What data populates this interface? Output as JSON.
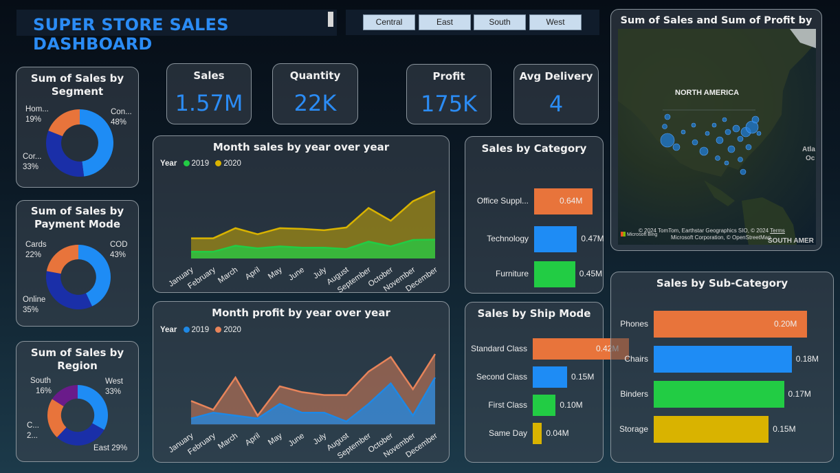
{
  "header": {
    "title": "SUPER STORE SALES DASHBOARD"
  },
  "region_slicer": {
    "options": [
      "Central",
      "East",
      "South",
      "West"
    ]
  },
  "kpis": [
    {
      "label": "Sales",
      "value": "1.57M"
    },
    {
      "label": "Quantity",
      "value": "22K"
    },
    {
      "label": "Profit",
      "value": "175K"
    },
    {
      "label": "Avg Delivery",
      "value": "4"
    }
  ],
  "segment": {
    "title_line1": "Sum of Sales by",
    "title_line2": "Segment",
    "labels": [
      {
        "name": "Hom...",
        "pct": "19%"
      },
      {
        "name": "Con...",
        "pct": "48%"
      },
      {
        "name": "Cor...",
        "pct": "33%"
      }
    ]
  },
  "payment": {
    "title_line1": "Sum of Sales by",
    "title_line2": "Payment Mode",
    "labels": [
      {
        "name": "Cards",
        "pct": "22%"
      },
      {
        "name": "COD",
        "pct": "43%"
      },
      {
        "name": "Online",
        "pct": "35%"
      }
    ]
  },
  "region": {
    "title_line1": "Sum of Sales by",
    "title_line2": "Region",
    "labels": [
      {
        "name": "South",
        "pct": "16%"
      },
      {
        "name": "West",
        "pct": "33%"
      },
      {
        "name": "C...",
        "pct": "2..."
      },
      {
        "name": "East",
        "pct": "29%"
      }
    ]
  },
  "month_sales": {
    "title": "Month sales by year over year",
    "legend_title": "Year"
  },
  "month_profit": {
    "title": "Month profit by year over year",
    "legend_title": "Year"
  },
  "category": {
    "title": "Sales by Category"
  },
  "ship_mode": {
    "title": "Sales by Ship Mode"
  },
  "sub_category": {
    "title": "Sales by Sub-Category"
  },
  "map": {
    "title": "Sum of Sales and Sum of Profit by State",
    "label_continent": "NORTH AMERICA",
    "label_ocean": "Atla",
    "label_ocean2": "Oc",
    "label_south": "SOUTH AMER",
    "attribution_line1": "© 2024 TomTom, Earthstar Geographics SIO, © 2024",
    "attribution_terms": "Terms",
    "attribution_line2": "Microsoft Corporation, © OpenStreetMap",
    "bing_label": "Microsoft Bing"
  },
  "colors": {
    "accent": "#2b8cf5",
    "orange": "#e8743b",
    "green": "#22cc44",
    "yellow": "#d9b300",
    "navy": "#1a2fa8",
    "purple": "#6a1b8a"
  },
  "chart_data": [
    {
      "type": "pie",
      "title": "Sum of Sales by Segment",
      "categories": [
        "Consumer",
        "Corporate",
        "Home Office"
      ],
      "values": [
        48,
        33,
        19
      ]
    },
    {
      "type": "pie",
      "title": "Sum of Sales by Payment Mode",
      "categories": [
        "COD",
        "Online",
        "Cards"
      ],
      "values": [
        43,
        35,
        22
      ]
    },
    {
      "type": "pie",
      "title": "Sum of Sales by Region",
      "categories": [
        "West",
        "East",
        "Central",
        "South"
      ],
      "values": [
        33,
        29,
        22,
        16
      ]
    },
    {
      "type": "area",
      "title": "Month sales by year over year",
      "legend_title": "Year",
      "categories": [
        "January",
        "February",
        "March",
        "April",
        "May",
        "June",
        "July",
        "August",
        "September",
        "October",
        "November",
        "December"
      ],
      "series": [
        {
          "name": "2019",
          "color": "#22cc44",
          "values": [
            20,
            20,
            38,
            30,
            36,
            32,
            32,
            28,
            50,
            36,
            55,
            56
          ]
        },
        {
          "name": "2020",
          "color": "#d9b300",
          "values": [
            60,
            60,
            90,
            72,
            90,
            88,
            84,
            92,
            150,
            112,
            170,
            200
          ]
        }
      ]
    },
    {
      "type": "area",
      "title": "Month profit by year over year",
      "legend_title": "Year",
      "categories": [
        "January",
        "February",
        "March",
        "April",
        "May",
        "June",
        "July",
        "August",
        "September",
        "October",
        "November",
        "December"
      ],
      "series": [
        {
          "name": "2019",
          "color": "#1e88e5",
          "values": [
            2,
            4,
            3,
            2,
            7,
            4,
            4,
            1,
            7,
            14,
            3,
            16
          ]
        },
        {
          "name": "2020",
          "color": "#e8845a",
          "values": [
            8,
            5,
            16,
            3,
            13,
            11,
            10,
            10,
            18,
            23,
            12,
            24
          ]
        }
      ]
    },
    {
      "type": "bar",
      "title": "Sales by Category",
      "categories": [
        "Office Suppl...",
        "Technology",
        "Furniture"
      ],
      "values": [
        0.64,
        0.47,
        0.45
      ],
      "value_labels": [
        "0.64M",
        "0.47M",
        "0.45M"
      ],
      "colors": [
        "#e8743b",
        "#1e8cf5",
        "#22cc44"
      ],
      "orientation": "horizontal"
    },
    {
      "type": "bar",
      "title": "Sales by Ship Mode",
      "categories": [
        "Standard Class",
        "Second Class",
        "First Class",
        "Same Day"
      ],
      "values": [
        0.42,
        0.15,
        0.1,
        0.04
      ],
      "value_labels": [
        "0.42M",
        "0.15M",
        "0.10M",
        "0.04M"
      ],
      "colors": [
        "#e8743b",
        "#1e8cf5",
        "#22cc44",
        "#d9b300"
      ],
      "orientation": "horizontal"
    },
    {
      "type": "bar",
      "title": "Sales by Sub-Category",
      "categories": [
        "Phones",
        "Chairs",
        "Binders",
        "Storage"
      ],
      "values": [
        0.2,
        0.18,
        0.17,
        0.15
      ],
      "value_labels": [
        "0.20M",
        "0.18M",
        "0.17M",
        "0.15M"
      ],
      "colors": [
        "#e8743b",
        "#1e8cf5",
        "#22cc44",
        "#d9b300"
      ],
      "orientation": "horizontal"
    }
  ]
}
